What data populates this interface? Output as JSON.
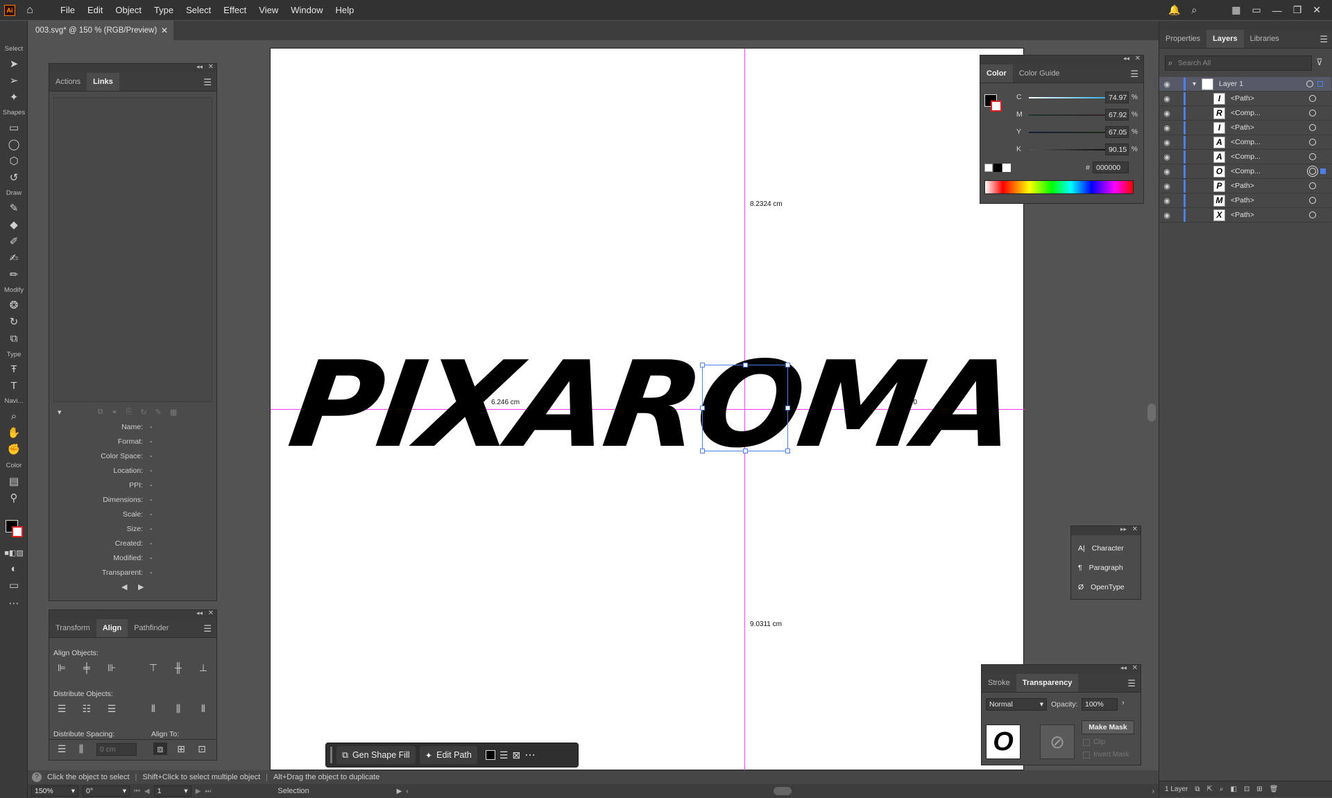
{
  "app": {
    "logo_text": "Ai"
  },
  "menu": [
    "File",
    "Edit",
    "Object",
    "Type",
    "Select",
    "Effect",
    "View",
    "Window",
    "Help"
  ],
  "document_tab": {
    "title": "003.svg* @ 150 % (RGB/Preview)",
    "close": "✕"
  },
  "toolbar": {
    "groups": [
      "Select",
      "Shapes",
      "Draw",
      "Modify",
      "Type",
      "Navi...",
      "Color"
    ]
  },
  "links_panel": {
    "tabs": [
      "Actions",
      "Links"
    ],
    "active_tab": "Links",
    "fields": [
      {
        "label": "Name:",
        "value": "-"
      },
      {
        "label": "Format:",
        "value": "-"
      },
      {
        "label": "Color Space:",
        "value": "-"
      },
      {
        "label": "Location:",
        "value": "-"
      },
      {
        "label": "PPI:",
        "value": "-"
      },
      {
        "label": "Dimensions:",
        "value": "-"
      },
      {
        "label": "Scale:",
        "value": "-"
      },
      {
        "label": "Size:",
        "value": "-"
      },
      {
        "label": "Created:",
        "value": "-"
      },
      {
        "label": "Modified:",
        "value": "-"
      },
      {
        "label": "Transparent:",
        "value": "-"
      }
    ]
  },
  "align_panel": {
    "tabs": [
      "Transform",
      "Align",
      "Pathfinder"
    ],
    "active_tab": "Align",
    "align_objects_label": "Align Objects:",
    "distribute_objects_label": "Distribute Objects:",
    "distribute_spacing_label": "Distribute Spacing:",
    "align_to_label": "Align To:",
    "spacing_value": "0 cm"
  },
  "color_panel": {
    "tabs": [
      "Color",
      "Color Guide"
    ],
    "active_tab": "Color",
    "channels": [
      {
        "label": "C",
        "value": "74.97",
        "unit": "%"
      },
      {
        "label": "M",
        "value": "67.92",
        "unit": "%"
      },
      {
        "label": "Y",
        "value": "67.05",
        "unit": "%"
      },
      {
        "label": "K",
        "value": "90.15",
        "unit": "%"
      }
    ],
    "hex_label": "#",
    "hex": "000000"
  },
  "type_panel": {
    "items": [
      "Character",
      "Paragraph",
      "OpenType"
    ]
  },
  "transparency_panel": {
    "tabs": [
      "Stroke",
      "Transparency"
    ],
    "active_tab": "Transparency",
    "blend_mode": "Normal",
    "opacity_label": "Opacity:",
    "opacity": "100%",
    "make_mask": "Make Mask",
    "clip": "Clip",
    "invert_mask": "Invert Mask"
  },
  "canvas": {
    "artwork_text": "PIXAROMA",
    "measure_top": "8.2324 cm",
    "measure_bottom": "9.0311 cm",
    "measure_left": "6.246 cm",
    "measure_right": "6.0"
  },
  "contextual_taskbar": {
    "gen_shape_fill": "Gen Shape Fill",
    "edit_path": "Edit Path"
  },
  "right_panel": {
    "tabs": [
      "Properties",
      "Layers",
      "Libraries"
    ],
    "active_tab": "Layers",
    "search_placeholder": "Search All",
    "layer_name": "Layer 1",
    "items": [
      {
        "name": "<Path>",
        "glyph": "I"
      },
      {
        "name": "<Comp...",
        "glyph": "R"
      },
      {
        "name": "<Path>",
        "glyph": "I"
      },
      {
        "name": "<Comp...",
        "glyph": "A"
      },
      {
        "name": "<Comp...",
        "glyph": "A"
      },
      {
        "name": "<Comp...",
        "glyph": "O"
      },
      {
        "name": "<Path>",
        "glyph": "P"
      },
      {
        "name": "<Path>",
        "glyph": "M"
      },
      {
        "name": "<Path>",
        "glyph": "X"
      }
    ],
    "footer_count": "1 Layer"
  },
  "status_bar": {
    "hint": "Click the object to select",
    "hint2": "Shift+Click to select multiple object",
    "hint3": "Alt+Drag the object to duplicate",
    "zoom": "150%",
    "rotation": "0°",
    "artboard_num": "1",
    "tool": "Selection"
  }
}
